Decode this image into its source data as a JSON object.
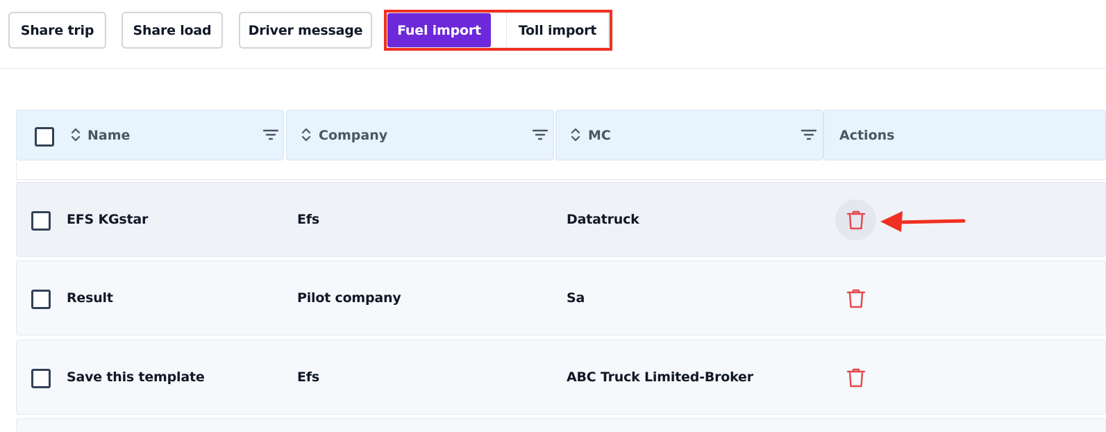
{
  "toolbar": {
    "share_trip": "Share trip",
    "share_load": "Share load",
    "driver_message": "Driver message",
    "fuel_import": "Fuel import",
    "toll_import": "Toll import"
  },
  "table": {
    "columns": {
      "name": "Name",
      "company": "Company",
      "mc": "MC",
      "actions": "Actions"
    },
    "rows": [
      {
        "name": "EFS KGstar",
        "company": "Efs",
        "mc": "Datatruck"
      },
      {
        "name": "Result",
        "company": "Pilot company",
        "mc": "Sa"
      },
      {
        "name": "Save this template",
        "company": "Efs",
        "mc": "ABC Truck Limited-Broker"
      }
    ]
  },
  "icons": {
    "sort": "sort-icon",
    "filter": "filter-icon",
    "delete": "trash-icon",
    "annotation": "arrow-left-icon"
  },
  "colors": {
    "accent": "#6d28d9",
    "highlight": "#f03022",
    "header_bg": "#e7f3fd",
    "delete": "#e5484d"
  }
}
